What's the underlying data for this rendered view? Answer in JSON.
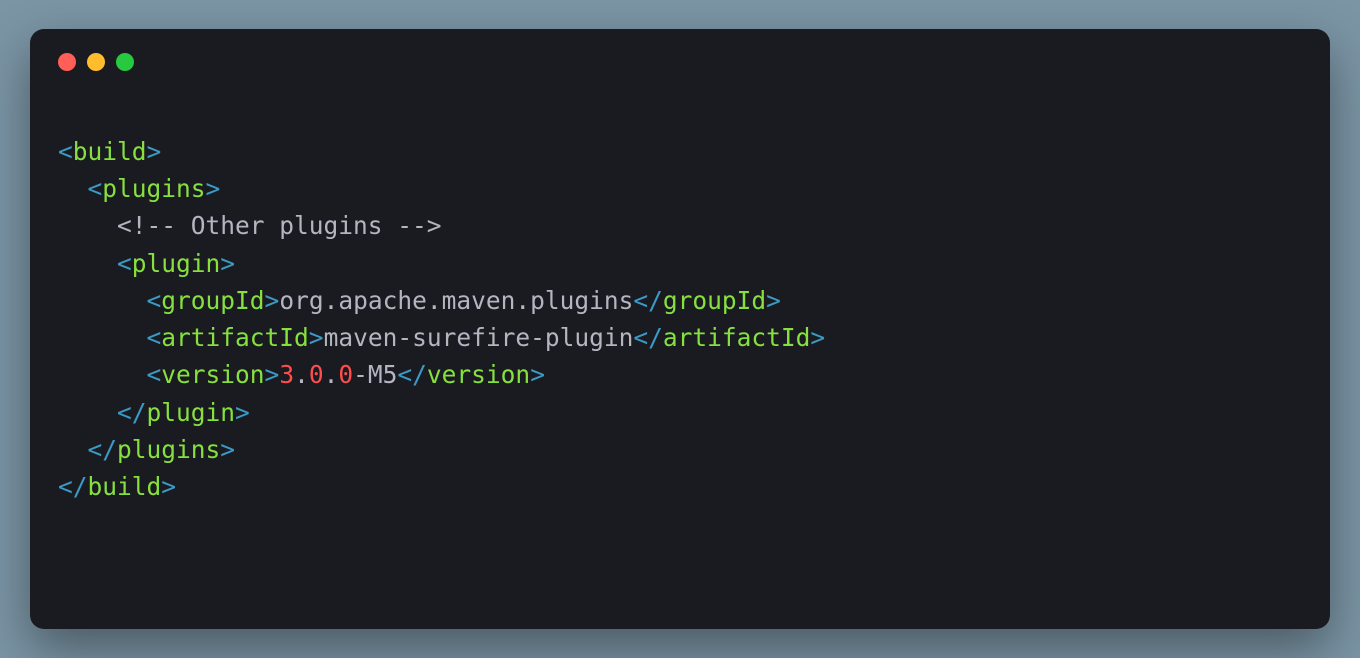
{
  "lines": {
    "l1": {
      "bracket_open": "<",
      "tag": "build",
      "bracket_close": ">"
    },
    "l2": {
      "indent": "  ",
      "bracket_open": "<",
      "tag": "plugins",
      "bracket_close": ">"
    },
    "l3": {
      "indent": "    ",
      "comment": "<!-- Other plugins -->"
    },
    "l4": {
      "indent": "    ",
      "bracket_open": "<",
      "tag": "plugin",
      "bracket_close": ">"
    },
    "l5": {
      "indent": "      ",
      "bracket_open": "<",
      "tag_open": "groupId",
      "bracket_close_open": ">",
      "text": "org.apache.maven.plugins",
      "bracket_open_close": "</",
      "tag_close": "groupId",
      "bracket_close": ">"
    },
    "l6": {
      "indent": "      ",
      "bracket_open": "<",
      "tag_open": "artifactId",
      "bracket_close_open": ">",
      "text": "maven-surefire-plugin",
      "bracket_open_close": "</",
      "tag_close": "artifactId",
      "bracket_close": ">"
    },
    "l7": {
      "indent": "      ",
      "bracket_open": "<",
      "tag_open": "version",
      "bracket_close_open": ">",
      "num1": "3",
      "dot1": ".",
      "num2": "0",
      "dot2": ".",
      "num3": "0",
      "suffix": "-M5",
      "bracket_open_close": "</",
      "tag_close": "version",
      "bracket_close": ">"
    },
    "l8": {
      "indent": "    ",
      "bracket_open": "</",
      "tag": "plugin",
      "bracket_close": ">"
    },
    "l9": {
      "indent": "  ",
      "bracket_open": "</",
      "tag": "plugins",
      "bracket_close": ">"
    },
    "l10": {
      "bracket_open": "</",
      "tag": "build",
      "bracket_close": ">"
    }
  }
}
